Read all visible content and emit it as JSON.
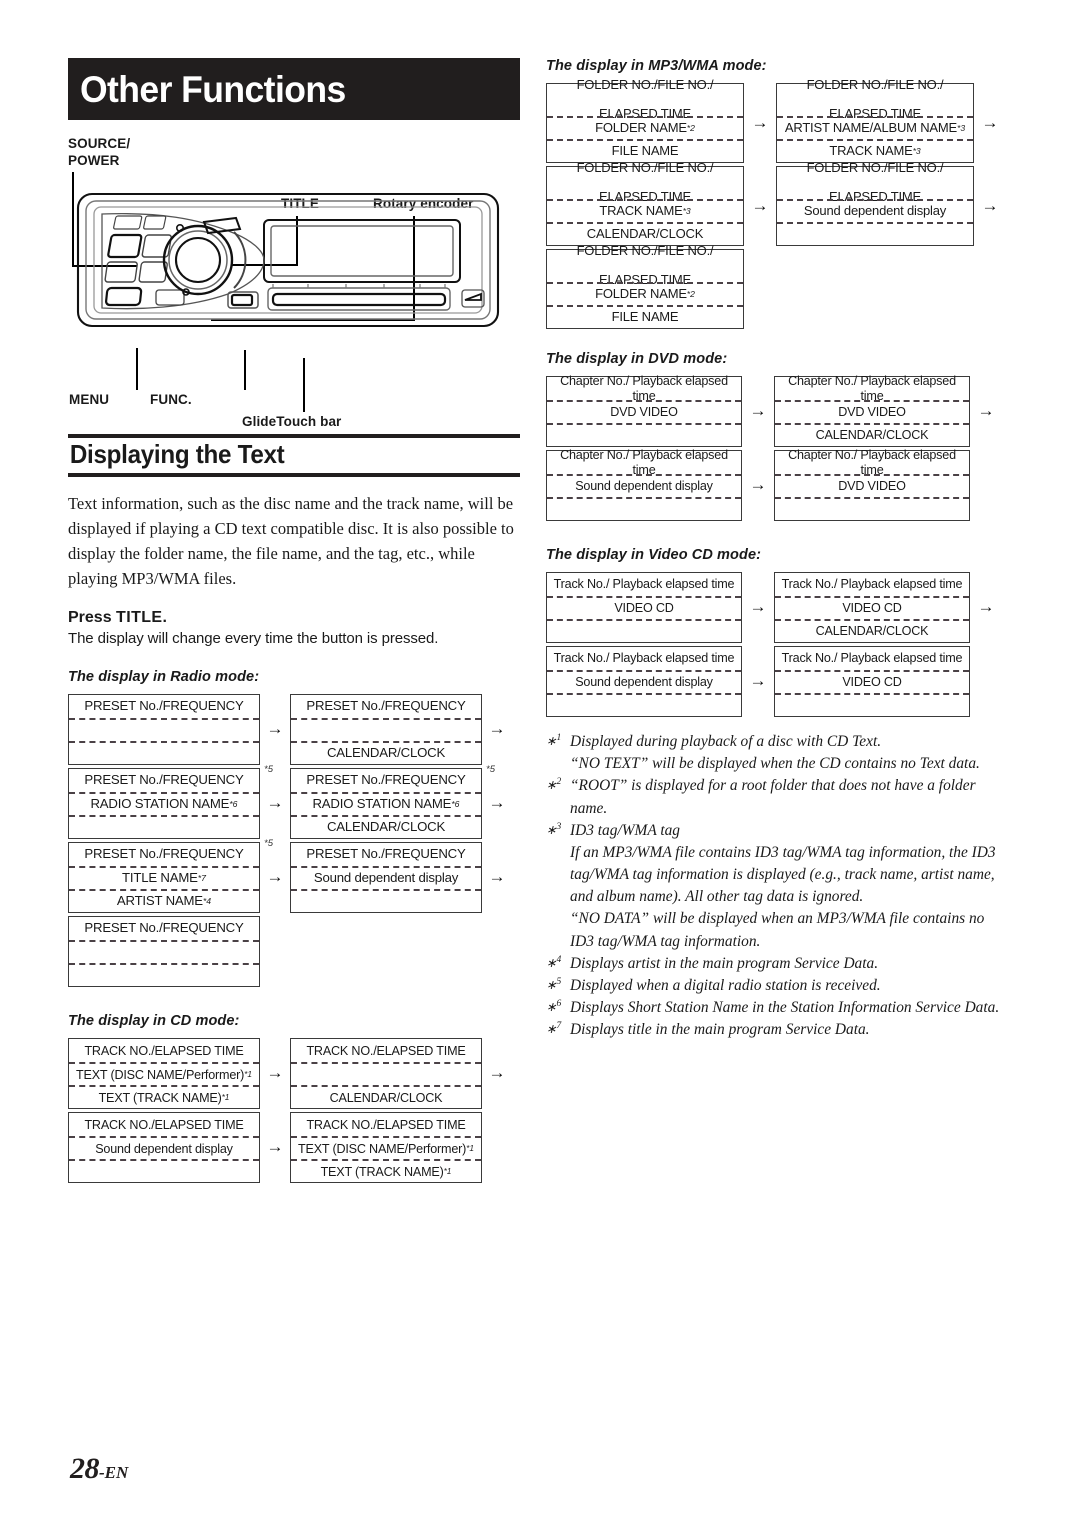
{
  "page": {
    "chapter_title": "Other Functions",
    "page_number": "28",
    "page_number_suffix": "-EN"
  },
  "figure": {
    "labels": {
      "source_power_line1": "SOURCE/",
      "source_power_line2": "POWER",
      "title": "TITLE",
      "rotary_encoder": "Rotary encoder",
      "menu": "MENU",
      "func": "FUNC.",
      "glidetouch": "GlideTouch bar"
    }
  },
  "section": {
    "heading": "Displaying the Text",
    "body": "Text information, such as the disc name and the track name, will be displayed if playing a CD text compatible disc. It is also possible to display the folder name, the file name, and the tag, etc., while playing MP3/WMA files.",
    "press_prefix": "Press ",
    "press_key": "TITLE",
    "press_suffix": ".",
    "press_note": "The display will change every time the button is pressed."
  },
  "modes": {
    "radio": {
      "caption": "The display in Radio mode:",
      "boxes": [
        {
          "id": "radio-1",
          "rows": [
            "PRESET No./FREQUENCY",
            "",
            ""
          ],
          "marks": [
            "",
            "",
            ""
          ],
          "corner": "",
          "arrow_after": true
        },
        {
          "id": "radio-2",
          "rows": [
            "PRESET No./FREQUENCY",
            "",
            "CALENDAR/CLOCK"
          ],
          "marks": [
            "",
            "",
            ""
          ],
          "corner": "",
          "arrow_after": true
        },
        {
          "id": "radio-3",
          "rows": [
            "PRESET No./FREQUENCY",
            "RADIO STATION NAME",
            ""
          ],
          "marks": [
            "",
            "*6",
            ""
          ],
          "corner": "*5",
          "arrow_after": true
        },
        {
          "id": "radio-4",
          "rows": [
            "PRESET No./FREQUENCY",
            "RADIO STATION NAME",
            "CALENDAR/CLOCK"
          ],
          "marks": [
            "",
            "*6",
            ""
          ],
          "corner": "*5",
          "arrow_after": true
        },
        {
          "id": "radio-5",
          "rows": [
            "PRESET No./FREQUENCY",
            "TITLE NAME",
            "ARTIST NAME"
          ],
          "marks": [
            "",
            "*7",
            "*4"
          ],
          "corner": "*5",
          "arrow_after": true
        },
        {
          "id": "radio-6",
          "rows": [
            "PRESET No./FREQUENCY",
            "Sound dependent display",
            ""
          ],
          "marks": [
            "",
            "",
            ""
          ],
          "corner": "",
          "arrow_after": true
        },
        {
          "id": "radio-7",
          "rows": [
            "PRESET No./FREQUENCY",
            "",
            ""
          ],
          "marks": [
            "",
            "",
            ""
          ],
          "corner": "",
          "arrow_after": false
        }
      ]
    },
    "cd": {
      "caption": "The display in CD mode:",
      "boxes": [
        {
          "id": "cd-1",
          "rows": [
            "TRACK NO./ELAPSED TIME",
            "TEXT (DISC NAME/Performer)",
            "TEXT (TRACK NAME)"
          ],
          "marks": [
            "",
            "*1",
            "*1"
          ],
          "corner": "",
          "arrow_after": true
        },
        {
          "id": "cd-2",
          "rows": [
            "TRACK NO./ELAPSED TIME",
            "",
            "CALENDAR/CLOCK"
          ],
          "marks": [
            "",
            "",
            ""
          ],
          "corner": "",
          "arrow_after": true
        },
        {
          "id": "cd-3",
          "rows": [
            "TRACK NO./ELAPSED TIME",
            "Sound dependent display",
            ""
          ],
          "marks": [
            "",
            "",
            ""
          ],
          "corner": "",
          "arrow_after": true
        },
        {
          "id": "cd-4",
          "rows": [
            "TRACK NO./ELAPSED TIME",
            "TEXT (DISC NAME/Performer)",
            "TEXT (TRACK NAME)"
          ],
          "marks": [
            "",
            "*1",
            "*1"
          ],
          "corner": "",
          "arrow_after": false
        }
      ]
    },
    "mp3wma": {
      "caption": "The display in MP3/WMA mode:",
      "boxes": [
        {
          "id": "mp3-1",
          "rows": [
            "FOLDER NO./FILE NO./\nELAPSED TIME",
            "FOLDER NAME",
            "FILE  NAME"
          ],
          "marks": [
            "",
            "*2",
            ""
          ],
          "corner": "",
          "arrow_after": true
        },
        {
          "id": "mp3-2",
          "rows": [
            "FOLDER NO./FILE NO./\nELAPSED TIME",
            "ARTIST NAME/ALBUM NAME",
            "TRACK NAME"
          ],
          "marks": [
            "",
            "*3",
            "*3"
          ],
          "corner": "",
          "arrow_after": true
        },
        {
          "id": "mp3-3",
          "rows": [
            "FOLDER NO./FILE NO./\nELAPSED TIME",
            "TRACK NAME",
            "CALENDAR/CLOCK"
          ],
          "marks": [
            "",
            "*3",
            ""
          ],
          "corner": "",
          "arrow_after": true
        },
        {
          "id": "mp3-4",
          "rows": [
            "FOLDER NO./FILE NO./\nELAPSED TIME",
            "Sound dependent display",
            ""
          ],
          "marks": [
            "",
            "",
            ""
          ],
          "corner": "",
          "arrow_after": true
        },
        {
          "id": "mp3-5",
          "rows": [
            "FOLDER NO./FILE NO./\nELAPSED TIME",
            "FOLDER NAME",
            "FILE  NAME"
          ],
          "marks": [
            "",
            "*2",
            ""
          ],
          "corner": "",
          "arrow_after": false
        }
      ]
    },
    "dvd": {
      "caption": "The display in DVD mode:",
      "boxes": [
        {
          "id": "dvd-1",
          "rows": [
            "Chapter No./ Playback elapsed time",
            "DVD VIDEO",
            ""
          ],
          "marks": [
            "",
            "",
            ""
          ],
          "corner": "",
          "arrow_after": true
        },
        {
          "id": "dvd-2",
          "rows": [
            "Chapter No./ Playback elapsed time",
            "DVD VIDEO",
            "CALENDAR/CLOCK"
          ],
          "marks": [
            "",
            "",
            ""
          ],
          "corner": "",
          "arrow_after": true
        },
        {
          "id": "dvd-3",
          "rows": [
            "Chapter No./ Playback elapsed time",
            "Sound dependent display",
            ""
          ],
          "marks": [
            "",
            "",
            ""
          ],
          "corner": "",
          "arrow_after": true
        },
        {
          "id": "dvd-4",
          "rows": [
            "Chapter No./ Playback elapsed time",
            "DVD VIDEO",
            ""
          ],
          "marks": [
            "",
            "",
            ""
          ],
          "corner": "",
          "arrow_after": false
        }
      ]
    },
    "videocd": {
      "caption": "The display in Video CD mode:",
      "boxes": [
        {
          "id": "vcd-1",
          "rows": [
            "Track No./ Playback elapsed time",
            "VIDEO CD",
            ""
          ],
          "marks": [
            "",
            "",
            ""
          ],
          "corner": "",
          "arrow_after": true
        },
        {
          "id": "vcd-2",
          "rows": [
            "Track No./ Playback elapsed time",
            "VIDEO CD",
            "CALENDAR/CLOCK"
          ],
          "marks": [
            "",
            "",
            ""
          ],
          "corner": "",
          "arrow_after": true
        },
        {
          "id": "vcd-3",
          "rows": [
            "Track No./ Playback elapsed time",
            "Sound dependent display",
            ""
          ],
          "marks": [
            "",
            "",
            ""
          ],
          "corner": "",
          "arrow_after": true
        },
        {
          "id": "vcd-4",
          "rows": [
            "Track No./ Playback elapsed time",
            "VIDEO CD",
            ""
          ],
          "marks": [
            "",
            "",
            ""
          ],
          "corner": "",
          "arrow_after": false
        }
      ]
    }
  },
  "footnotes": [
    {
      "key": "1",
      "lines": [
        "Displayed during playback of a disc with CD Text.",
        "“NO TEXT” will be displayed when the CD contains no Text data."
      ]
    },
    {
      "key": "2",
      "lines": [
        "“ROOT” is displayed for a root folder that does not have a folder name."
      ]
    },
    {
      "key": "3",
      "lines": [
        "ID3 tag/WMA tag",
        "If an MP3/WMA file contains ID3 tag/WMA tag information, the ID3 tag/WMA tag information is displayed (e.g., track name, artist name, and album name). All other tag data is ignored.",
        "“NO DATA” will be displayed when an MP3/WMA file contains no ID3 tag/WMA tag information."
      ]
    },
    {
      "key": "4",
      "lines": [
        "Displays artist in the main program Service Data."
      ]
    },
    {
      "key": "5",
      "lines": [
        "Displayed when a digital radio station is received."
      ]
    },
    {
      "key": "6",
      "lines": [
        "Displays Short Station Name in the Station Information Service Data."
      ]
    },
    {
      "key": "7",
      "lines": [
        "Displays title in the main program Service Data."
      ]
    }
  ],
  "colors": {
    "banner_bg": "#211e1e",
    "rule": "#211e1e",
    "box_border": "#3a3a3a",
    "dash": "#4a4146"
  }
}
